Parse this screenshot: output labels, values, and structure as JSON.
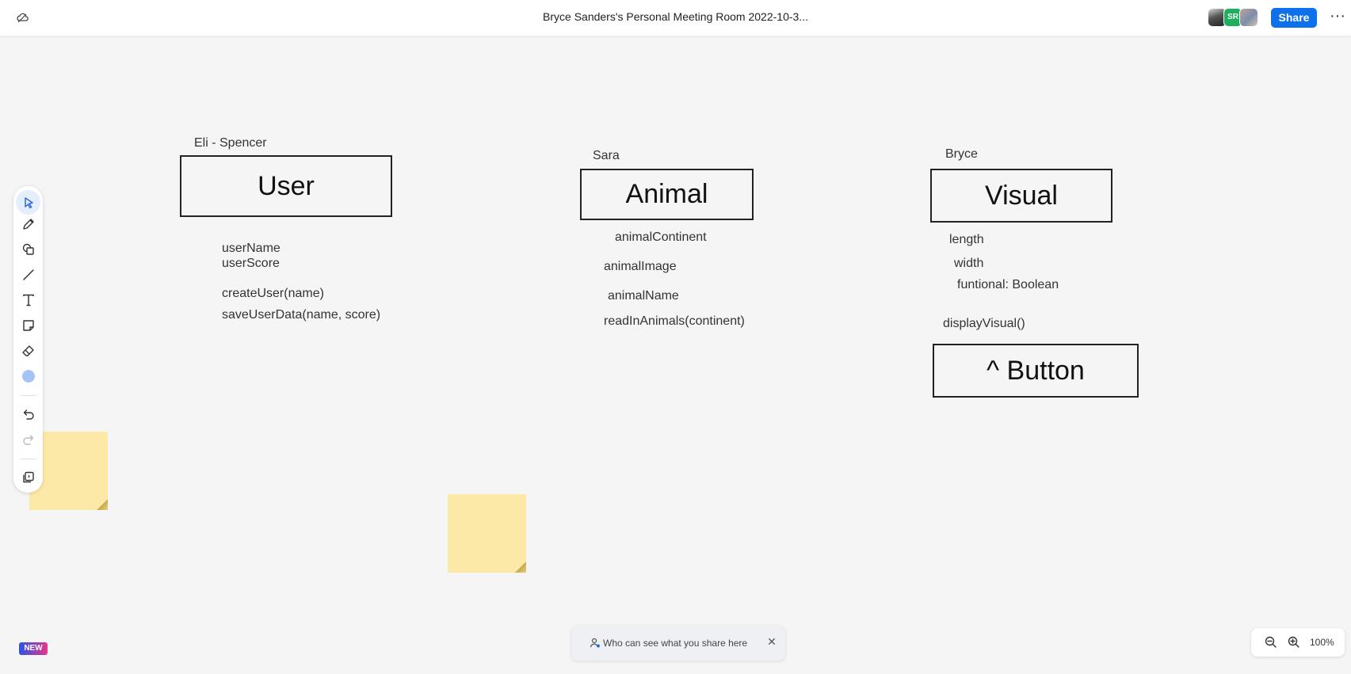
{
  "header": {
    "title": "Bryce Sanders's Personal Meeting Room 2022-10-3...",
    "avatar_initials": "SR",
    "share_label": "Share",
    "more_label": "···"
  },
  "canvas": {
    "user_owner": "Eli - Spencer",
    "user_box": "User",
    "user_fields": [
      "userName",
      "userScore",
      "createUser(name)",
      "saveUserData(name, score)"
    ],
    "animal_owner": "Sara",
    "animal_box": "Animal",
    "animal_fields": [
      "animalContinent",
      "animalImage",
      "animalName",
      "readInAnimals(continent)"
    ],
    "visual_owner": "Bryce",
    "visual_box": "Visual",
    "visual_fields": [
      "length",
      "width",
      "funtional: Boolean",
      "displayVisual()"
    ],
    "button_box": "^ Button"
  },
  "toolbar": {
    "tools": [
      "select-icon",
      "pen-icon",
      "shapes-icon",
      "line-icon",
      "text-icon",
      "sticky-note-icon",
      "eraser-icon",
      "color-icon",
      "undo-icon",
      "redo-icon",
      "pages-icon"
    ],
    "selected_color": "#a5c4f5"
  },
  "footer": {
    "new_badge": "NEW",
    "privacy_text": "Who can see what you share here",
    "zoom_level": "100%"
  },
  "colors": {
    "accent": "#0e71eb",
    "sticky": "#fde9a7",
    "canvas_bg": "#f5f5f5"
  }
}
